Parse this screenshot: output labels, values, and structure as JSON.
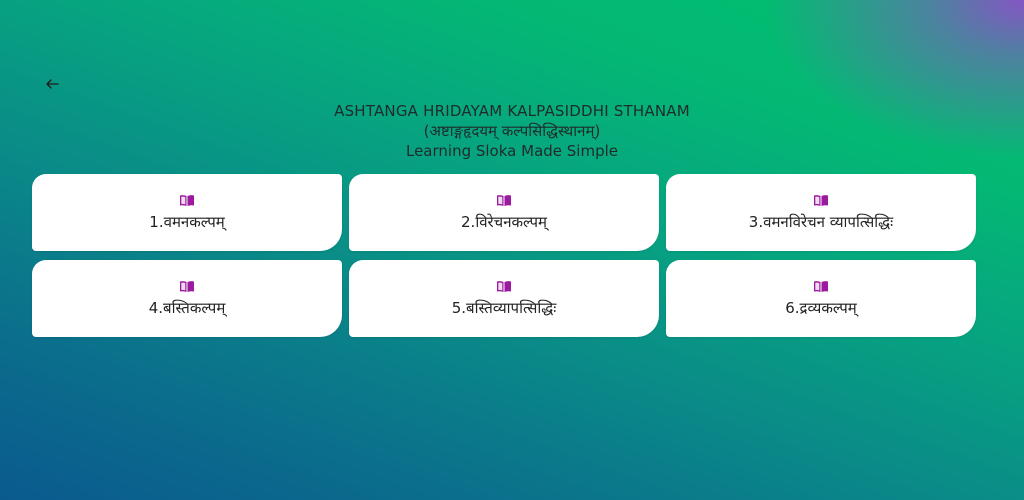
{
  "header": {
    "title": "ASHTANGA HRIDAYAM KALPASIDDHI STHANAM",
    "subtitle_sanskrit": "(अष्टाङ्गहृदयम् कल्पसिद्धिस्थानम्)",
    "tagline": "Learning Sloka Made Simple"
  },
  "icons": {
    "back": "arrow-left-icon",
    "chapter": "open-book-icon"
  },
  "colors": {
    "book_icon": "#9c1aa0",
    "card_background": "#ffffff",
    "text": "#1f2b2b"
  },
  "chapters": [
    {
      "label": "1.वमनकल्पम्"
    },
    {
      "label": "2.विरेचनकल्पम्"
    },
    {
      "label": "3.वमनविरेचन व्यापत्सिद्धिः"
    },
    {
      "label": "4.बस्तिकल्पम्"
    },
    {
      "label": "5.बस्तिव्यापत्सिद्धिः"
    },
    {
      "label": "6.द्रव्यकल्पम्"
    }
  ]
}
